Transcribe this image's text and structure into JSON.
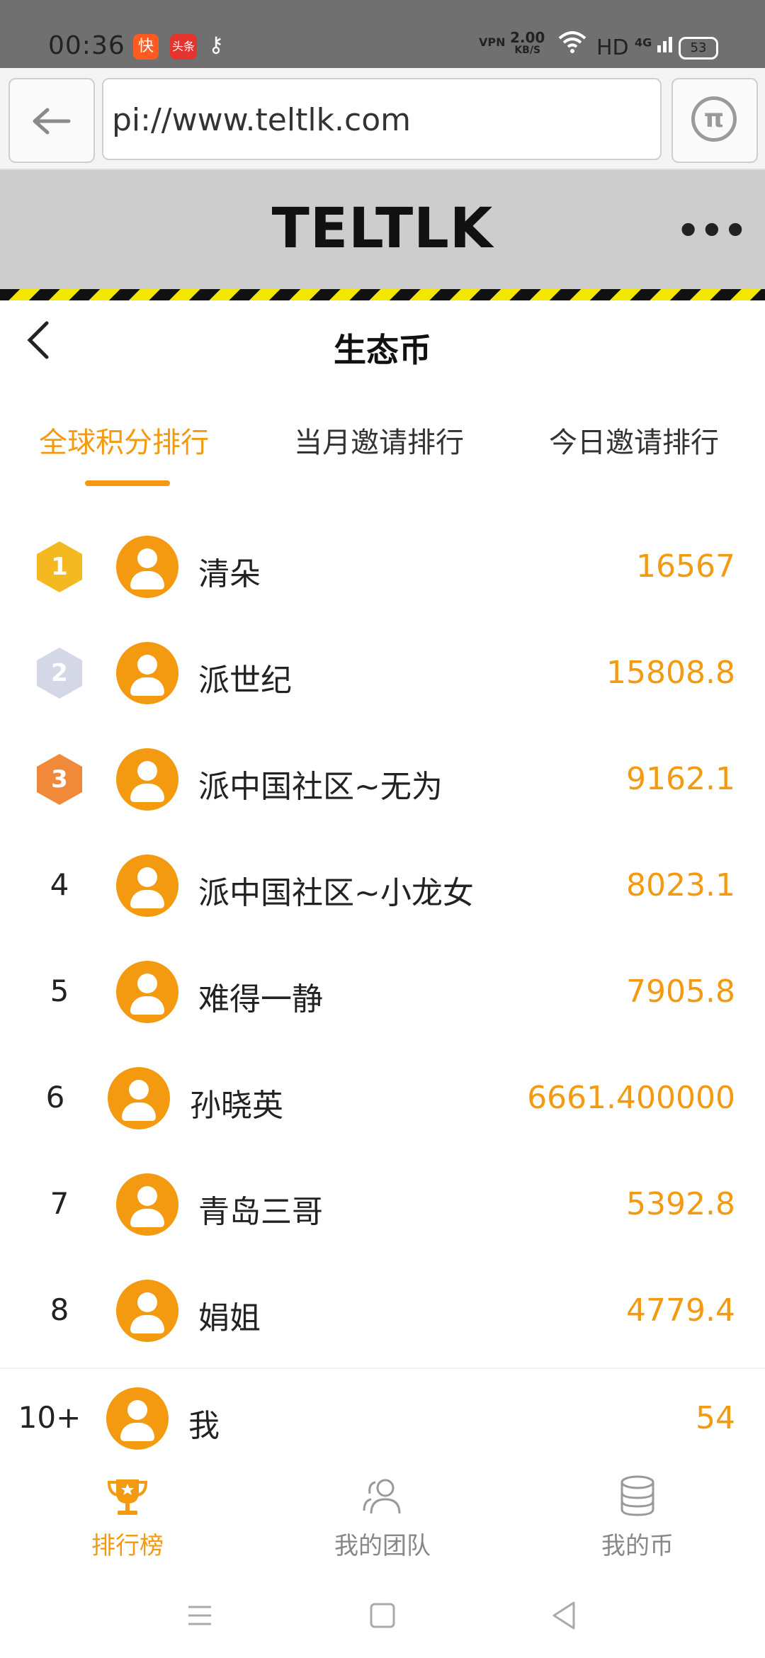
{
  "status_bar": {
    "time": "00:36",
    "app1": "快",
    "app2": "头条",
    "vpn": "VPN",
    "speed": "2.00",
    "speed_unit": "KB/S",
    "network": "HD",
    "cell": "4G",
    "battery": "53"
  },
  "browser": {
    "url": "pi://www.teltlk.com",
    "pi_symbol": "π"
  },
  "site": {
    "title": "TELTLK",
    "more": "•••"
  },
  "page": {
    "title": "生态币"
  },
  "tabs": [
    {
      "label": "全球积分排行",
      "active": true
    },
    {
      "label": "当月邀请排行",
      "active": false
    },
    {
      "label": "今日邀请排行",
      "active": false
    }
  ],
  "ranking": [
    {
      "rank": "1",
      "name": "清朵",
      "score": "16567"
    },
    {
      "rank": "2",
      "name": "派世纪",
      "score": "15808.8"
    },
    {
      "rank": "3",
      "name": "派中国社区~无为",
      "score": "9162.1"
    },
    {
      "rank": "4",
      "name": "派中国社区~小龙女",
      "score": "8023.1"
    },
    {
      "rank": "5",
      "name": "难得一静",
      "score": "7905.8"
    },
    {
      "rank": "6",
      "name": "孙晓英",
      "score": "6661.400000"
    },
    {
      "rank": "7",
      "name": "青岛三哥",
      "score": "5392.8"
    },
    {
      "rank": "8",
      "name": "娟姐",
      "score": "4779.4"
    }
  ],
  "me": {
    "rank": "10+",
    "name": "我",
    "score": "54"
  },
  "bottom_nav": [
    {
      "label": "排行榜",
      "icon": "trophy-icon",
      "active": true
    },
    {
      "label": "我的团队",
      "icon": "team-icon",
      "active": false
    },
    {
      "label": "我的币",
      "icon": "coins-icon",
      "active": false
    }
  ],
  "colors": {
    "accent": "#f39a10",
    "gold": "#f4b821",
    "silver": "#d4d7e6",
    "bronze": "#f08a3a"
  }
}
